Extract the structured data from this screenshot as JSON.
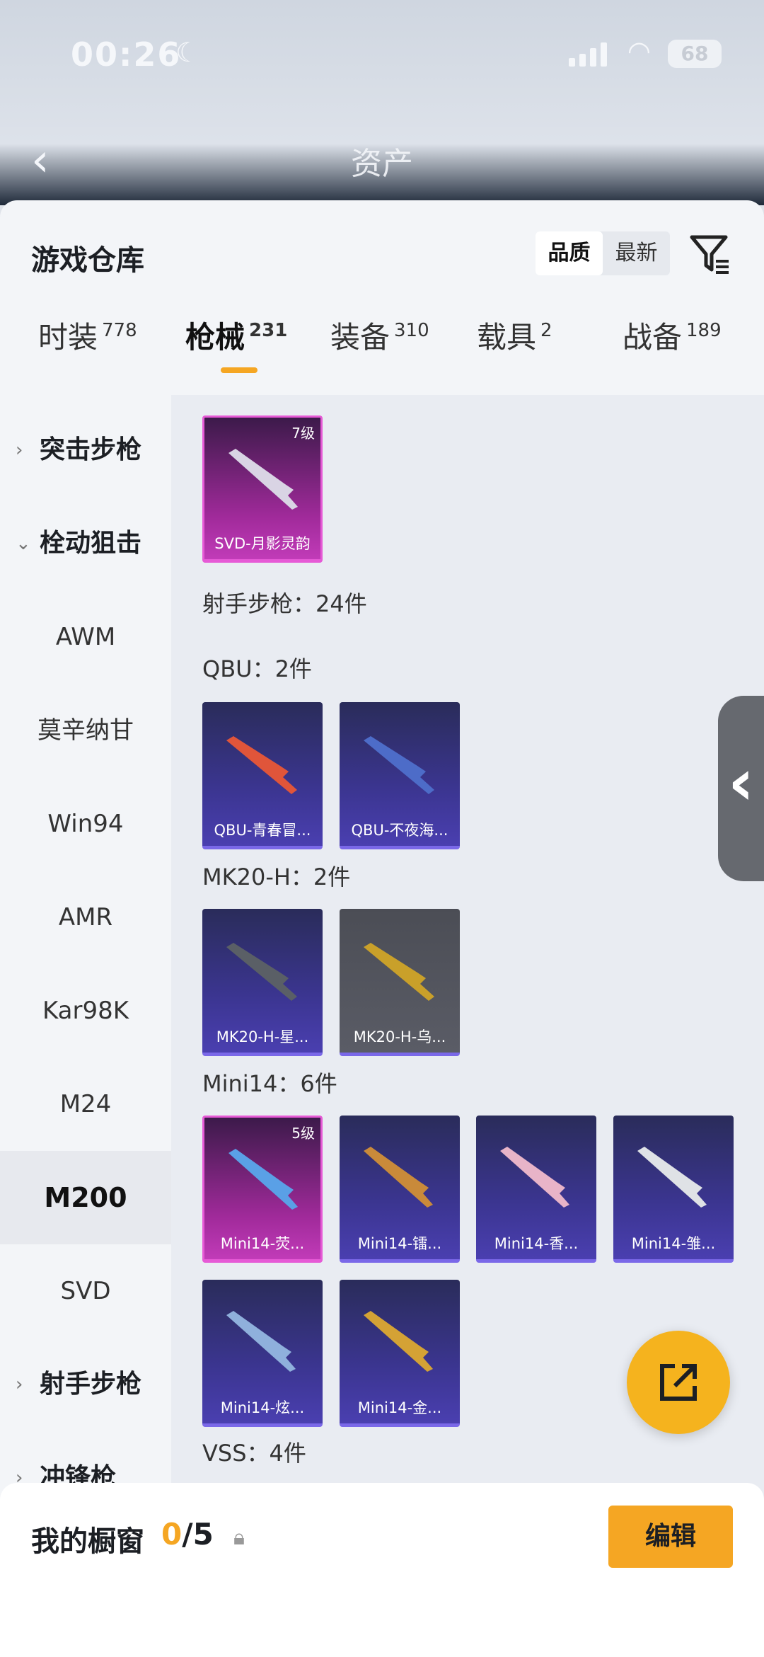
{
  "status_bar": {
    "time": "00:26",
    "battery": "68"
  },
  "header": {
    "title": "资产"
  },
  "sheet": {
    "title": "游戏仓库",
    "sort": {
      "quality": "品质",
      "latest": "最新"
    }
  },
  "tabs": [
    {
      "label": "时装",
      "count": "778"
    },
    {
      "label": "枪械",
      "count": "231"
    },
    {
      "label": "装备",
      "count": "310"
    },
    {
      "label": "载具",
      "count": "2"
    },
    {
      "label": "战备",
      "count": "189"
    }
  ],
  "categories": [
    {
      "label": "突击步枪"
    },
    {
      "label": "栓动狙击"
    },
    {
      "label": "AWM"
    },
    {
      "label": "莫辛纳甘"
    },
    {
      "label": "Win94"
    },
    {
      "label": "AMR"
    },
    {
      "label": "Kar98K"
    },
    {
      "label": "M24"
    },
    {
      "label": "M200"
    },
    {
      "label": "SVD"
    },
    {
      "label": "射手步枪"
    },
    {
      "label": "冲锋枪"
    }
  ],
  "content": {
    "svd_card": {
      "level": "7级",
      "name": "SVD-月影灵韵"
    },
    "marksman_header": "射手步枪：24件",
    "qbu": {
      "header": "QBU：2件",
      "items": [
        "QBU-青春冒...",
        "QBU-不夜海..."
      ]
    },
    "mk20": {
      "header": "MK20-H：2件",
      "items": [
        "MK20-H-星...",
        "MK20-H-乌..."
      ]
    },
    "mini14": {
      "header": "Mini14：6件",
      "first_level": "5级",
      "items": [
        "Mini14-荧...",
        "Mini14-镭...",
        "Mini14-香...",
        "Mini14-雏...",
        "Mini14-炫...",
        "Mini14-金..."
      ]
    },
    "vss": {
      "header": "VSS：4件"
    }
  },
  "showcase": {
    "label": "我的橱窗",
    "current": "0",
    "total": "/5",
    "edit": "编辑"
  },
  "colors": {
    "accent": "#f5a623",
    "card_purple": "#3b3590",
    "card_pink": "#c13bb8"
  }
}
